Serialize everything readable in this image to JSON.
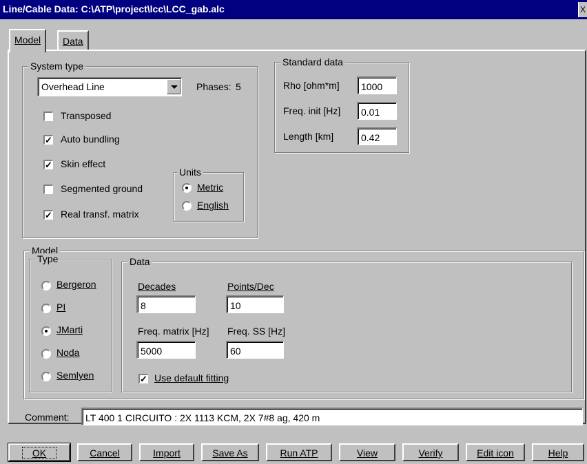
{
  "window": {
    "title": "Line/Cable Data: C:\\ATP\\project\\lcc\\LCC_gab.alc",
    "close_glyph": "X"
  },
  "tabs": [
    {
      "label": "Model"
    },
    {
      "label": "Data"
    }
  ],
  "system_type": {
    "legend": "System type",
    "type_value": "Overhead Line",
    "phases_label": "Phases:",
    "phases_value": "5",
    "options": [
      {
        "label": "Transposed",
        "checked": false
      },
      {
        "label": "Auto bundling",
        "checked": true
      },
      {
        "label": "Skin effect",
        "checked": true
      },
      {
        "label": "Segmented ground",
        "checked": false
      },
      {
        "label": "Real transf. matrix",
        "checked": true
      }
    ],
    "units": {
      "legend": "Units",
      "options": [
        {
          "label": "Metric",
          "selected": true
        },
        {
          "label": "English",
          "selected": false
        }
      ]
    }
  },
  "standard_data": {
    "legend": "Standard data",
    "rho_label": "Rho [ohm*m]",
    "rho_value": "1000",
    "freq_label": "Freq. init [Hz]",
    "freq_value": "0.01",
    "length_label": "Length [km]",
    "length_value": "0.42"
  },
  "model": {
    "legend": "Model",
    "type_legend": "Type",
    "types": [
      {
        "label": "Bergeron",
        "selected": false
      },
      {
        "label": "PI",
        "selected": false
      },
      {
        "label": "JMarti",
        "selected": true
      },
      {
        "label": "Noda",
        "selected": false
      },
      {
        "label": "Semlyen",
        "selected": false
      }
    ],
    "data_legend": "Data",
    "decades_label": "Decades",
    "decades_value": "8",
    "points_label": "Points/Dec",
    "points_value": "10",
    "freq_matrix_label": "Freq. matrix [Hz]",
    "freq_matrix_value": "5000",
    "freq_ss_label": "Freq. SS [Hz]",
    "freq_ss_value": "60",
    "use_default_label": "Use default fitting",
    "use_default_checked": true
  },
  "comment": {
    "label": "Comment:",
    "value": "LT 400  1 CIRCUITO : 2X 1113 KCM, 2X 7#8 ag, 420 m"
  },
  "buttons": [
    {
      "label": "OK"
    },
    {
      "label": "Cancel"
    },
    {
      "label": "Import"
    },
    {
      "label": "Save As"
    },
    {
      "label": "Run ATP"
    },
    {
      "label": "View"
    },
    {
      "label": "Verify"
    },
    {
      "label": "Edit icon"
    },
    {
      "label": "Help"
    }
  ],
  "icons": {
    "check": "check-mark",
    "dropdown": "chevron-down-icon"
  },
  "colors": {
    "titlebar": "#000080",
    "face": "#c0c0c0",
    "field": "#ffffff"
  }
}
